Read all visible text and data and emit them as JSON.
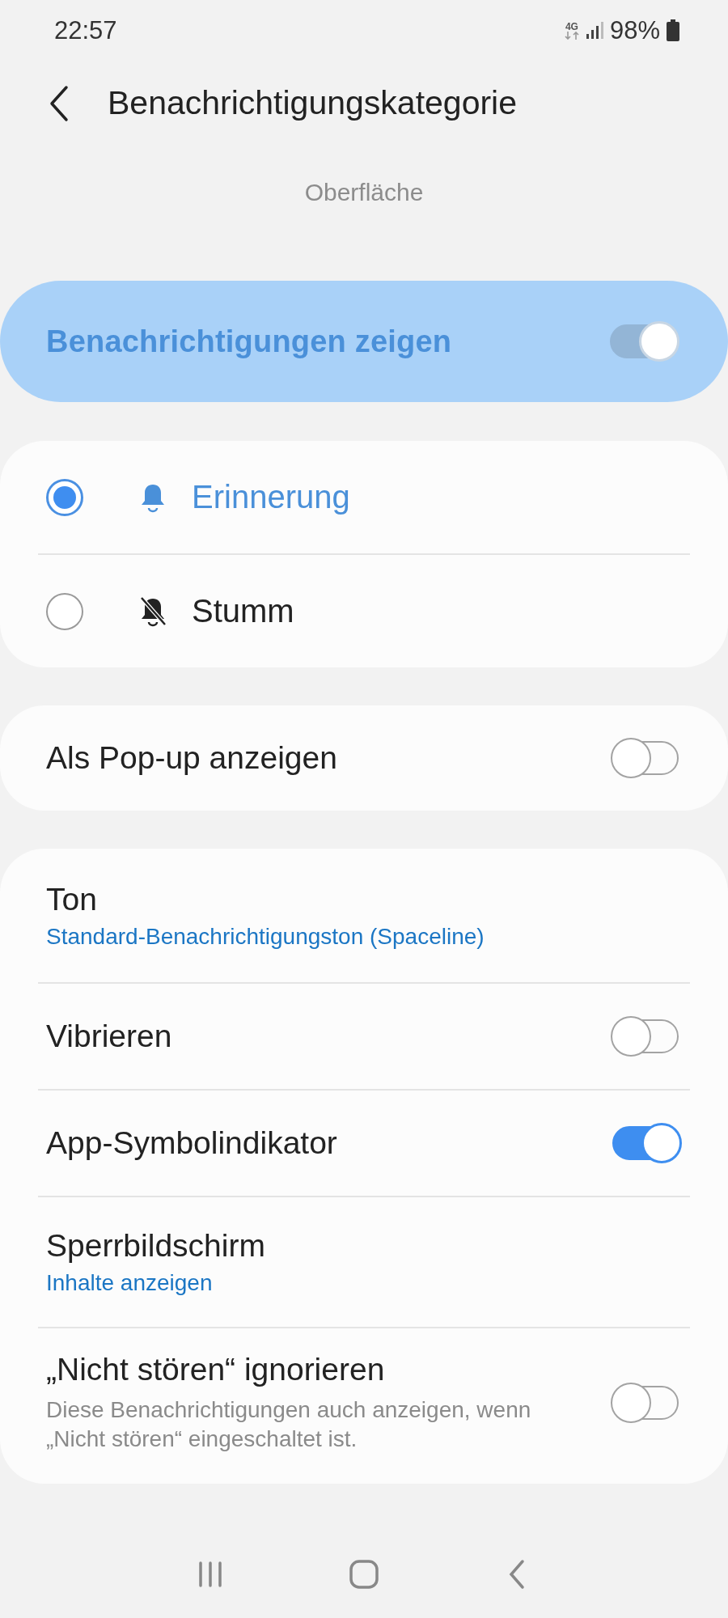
{
  "status_bar": {
    "time": "22:57",
    "network": "4G",
    "battery": "98%"
  },
  "header": {
    "title": "Benachrichtigungskategorie"
  },
  "section_label": "Oberfläche",
  "master": {
    "label": "Benachrichtigungen zeigen",
    "on": true
  },
  "alert_options": [
    {
      "kind": "bell",
      "label": "Erinnerung",
      "selected": true
    },
    {
      "kind": "bell-off",
      "label": "Stumm",
      "selected": false
    }
  ],
  "popup": {
    "label": "Als Pop-up anzeigen",
    "on": false
  },
  "settings": [
    {
      "kind": "link",
      "title": "Ton",
      "value": "Standard-Benachrichtigungston (Spaceline)"
    },
    {
      "kind": "switch",
      "title": "Vibrieren",
      "on": false
    },
    {
      "kind": "switch",
      "title": "App-Symbolindikator",
      "on": true
    },
    {
      "kind": "link",
      "title": "Sperrbildschirm",
      "value": "Inhalte anzeigen"
    },
    {
      "kind": "switch",
      "title": "„Nicht stören“ ignorieren",
      "description": "Diese Benachrichtigungen auch anzeigen, wenn „Nicht stören“ eingeschaltet ist.",
      "on": false
    }
  ]
}
